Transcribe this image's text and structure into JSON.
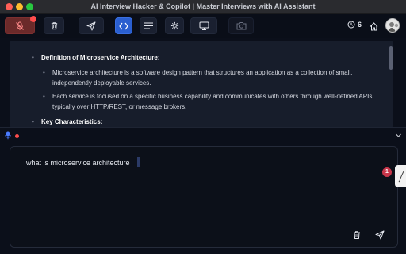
{
  "window": {
    "title": "AI Interview Hacker & Copilot | Master Interviews with AI Assistant"
  },
  "toolbar": {
    "buttons": [
      {
        "name": "microphone-muted",
        "icon": "mic-off-icon",
        "state": "recording-off"
      },
      {
        "name": "clear",
        "icon": "trash-icon"
      },
      {
        "name": "send",
        "icon": "send-icon"
      },
      {
        "name": "code-mode",
        "icon": "code-icon",
        "active": true
      },
      {
        "name": "text-mode",
        "icon": "lines-icon"
      },
      {
        "name": "ai-model",
        "icon": "gear-icon"
      },
      {
        "name": "screen-share",
        "icon": "monitor-icon"
      },
      {
        "name": "screenshot",
        "icon": "camera-icon",
        "disabled": true
      }
    ],
    "timer_value": "6"
  },
  "answer": {
    "sections": [
      {
        "heading": "Definition of Microservice Architecture:",
        "points": [
          "Microservice architecture is a software design pattern that structures an application as a collection of small, independently deployable services.",
          "Each service is focused on a specific business capability and communicates with others through well-defined APIs, typically over HTTP/REST, or message brokers."
        ]
      },
      {
        "heading": "Key Characteristics:",
        "points": []
      }
    ]
  },
  "input": {
    "query_prefix": "what",
    "query_rest": " is microservice architecture"
  },
  "notification": {
    "count": "1"
  },
  "colors": {
    "accent": "#2a5fd0",
    "record": "#ff4d4d",
    "muted_mic_bg": "#6b2a2a",
    "badge": "#c8364a"
  }
}
